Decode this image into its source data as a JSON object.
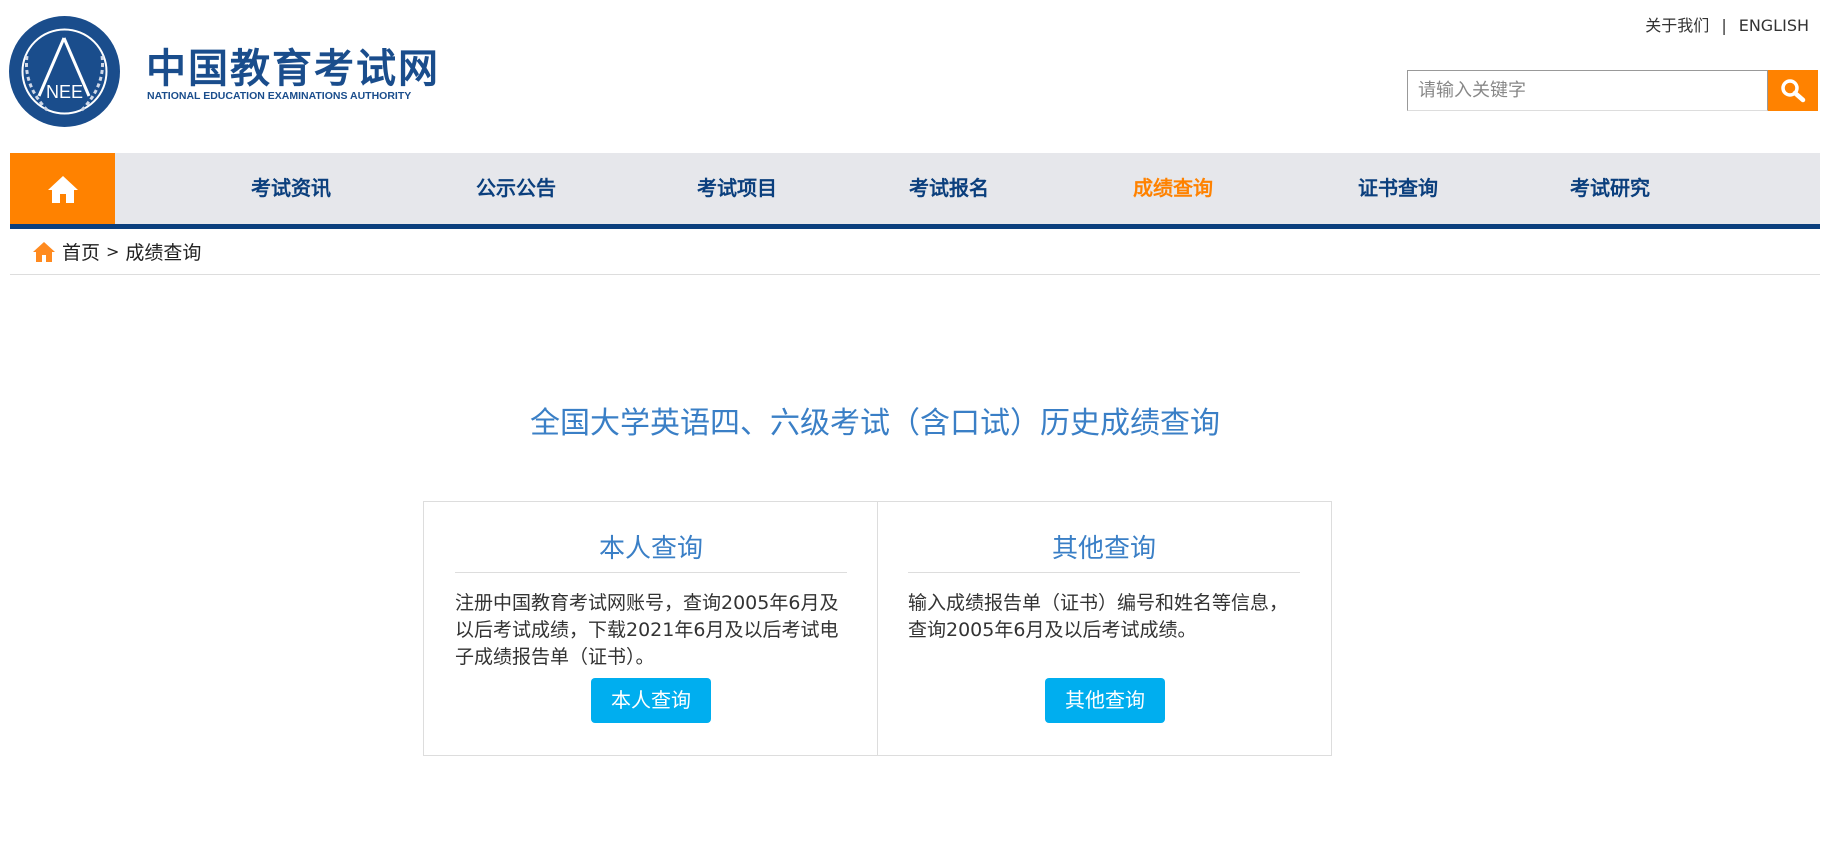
{
  "header": {
    "logo_cn": "中国教育考试网",
    "logo_en": "NATIONAL EDUCATION EXAMINATIONS AUTHORITY",
    "logo_emblem": "NEEA",
    "links": {
      "about": "关于我们",
      "separator": "|",
      "english": "ENGLISH"
    },
    "search": {
      "placeholder": "请输入关键字"
    }
  },
  "nav": {
    "items": [
      {
        "label": "考试资讯"
      },
      {
        "label": "公示公告"
      },
      {
        "label": "考试项目"
      },
      {
        "label": "考试报名"
      },
      {
        "label": "成绩查询",
        "active": true
      },
      {
        "label": "证书查询"
      },
      {
        "label": "考试研究"
      }
    ]
  },
  "breadcrumb": {
    "home": "首页",
    "sep": ">",
    "current": "成绩查询"
  },
  "main": {
    "title": "全国大学英语四、六级考试（含口试）历史成绩查询",
    "cards": [
      {
        "heading": "本人查询",
        "body": "注册中国教育考试网账号，查询2005年6月及以后考试成绩，下载2021年6月及以后考试电子成绩报告单（证书）。",
        "button": "本人查询"
      },
      {
        "heading": "其他查询",
        "body": "输入成绩报告单（证书）编号和姓名等信息，查询2005年6月及以后考试成绩。",
        "button": "其他查询"
      }
    ]
  },
  "colors": {
    "accent": "#ff8200",
    "brand": "#0b3f7d",
    "title": "#3a7fc6",
    "button": "#00aeef"
  }
}
